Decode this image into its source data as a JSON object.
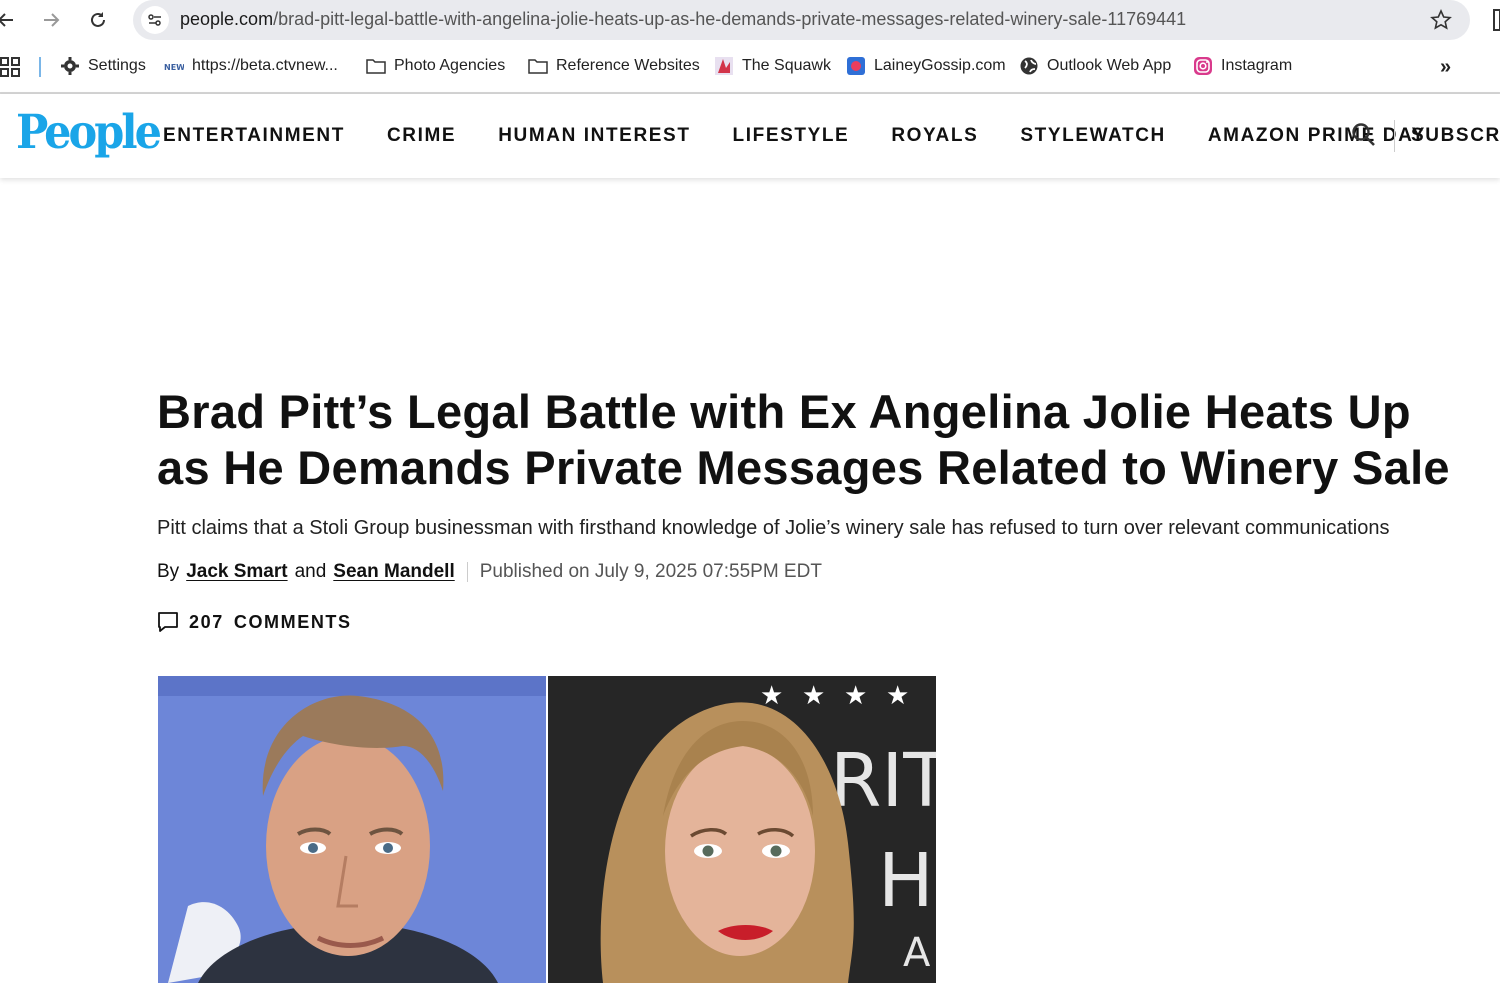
{
  "browser": {
    "url_domain": "people.com",
    "url_path": "/brad-pitt-legal-battle-with-angelina-jolie-heats-up-as-he-demands-private-messages-related-winery-sale-11769441"
  },
  "bookmarks": [
    {
      "label": "Settings",
      "icon": "gear-icon"
    },
    {
      "label": "https://beta.ctvnew...",
      "icon": "news-icon"
    },
    {
      "label": "Photo Agencies",
      "icon": "folder-icon"
    },
    {
      "label": "Reference Websites",
      "icon": "folder-icon"
    },
    {
      "label": "The Squawk",
      "icon": "squawk-icon"
    },
    {
      "label": "LaineyGossip.com",
      "icon": "lainey-icon"
    },
    {
      "label": "Outlook Web App",
      "icon": "globe-icon"
    },
    {
      "label": "Instagram",
      "icon": "instagram-icon"
    }
  ],
  "header": {
    "logo": "People",
    "nav": [
      "ENTERTAINMENT",
      "CRIME",
      "HUMAN INTEREST",
      "LIFESTYLE",
      "ROYALS",
      "STYLEWATCH",
      "AMAZON PRIME DAY"
    ],
    "subscribe": "SUBSCRI"
  },
  "article": {
    "headline": "Brad Pitt’s Legal Battle with Ex Angelina Jolie Heats Up as He Demands Private Messages Related to Winery Sale",
    "dek": "Pitt claims that a Stoli Group businessman with firsthand knowledge of Jolie’s winery sale has refused to turn over relevant communications",
    "by": "By",
    "author1": "Jack Smart",
    "and": "and",
    "author2": "Sean Mandell",
    "published": "Published on July 9, 2025 07:55PM EDT",
    "comments_count": "207",
    "comments_label": "COMMENTS"
  },
  "colors": {
    "brand": "#1aa5e8",
    "omnibox": "#e9eaee"
  }
}
